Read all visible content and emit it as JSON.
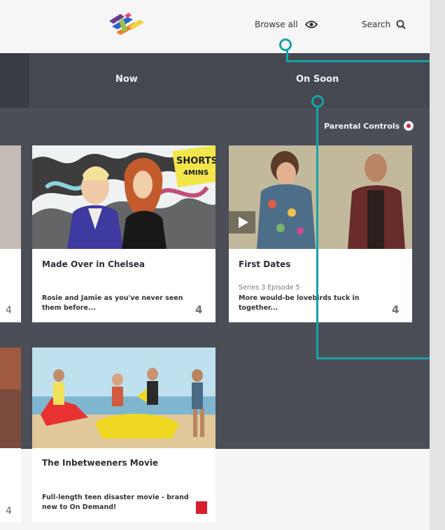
{
  "header": {
    "browse_label": "Browse all",
    "search_label": "Search"
  },
  "tabs": [
    {
      "label": "Now"
    },
    {
      "label": "On Soon"
    }
  ],
  "parental_controls_label": "Parental Controls",
  "cards": [
    {
      "title": "Made Over in Chelsea",
      "badge_line1": "SHORTS",
      "badge_line2": "4MINS",
      "meta": "",
      "description": "Rosie and Jamie as you've never seen them before..."
    },
    {
      "title": "First Dates",
      "meta": "Series 3 Episode 5",
      "description": "More would-be lovebirds tuck in together..."
    },
    {
      "title": "The Inbetweeners Movie",
      "meta": "",
      "description": "Full-length teen disaster movie - brand new to On Demand!"
    }
  ],
  "colors": {
    "accent_teal": "#17a3a7",
    "dark_panel": "#3b3e46",
    "badge_yellow": "#f2e64a",
    "film4_red": "#d6202f"
  }
}
